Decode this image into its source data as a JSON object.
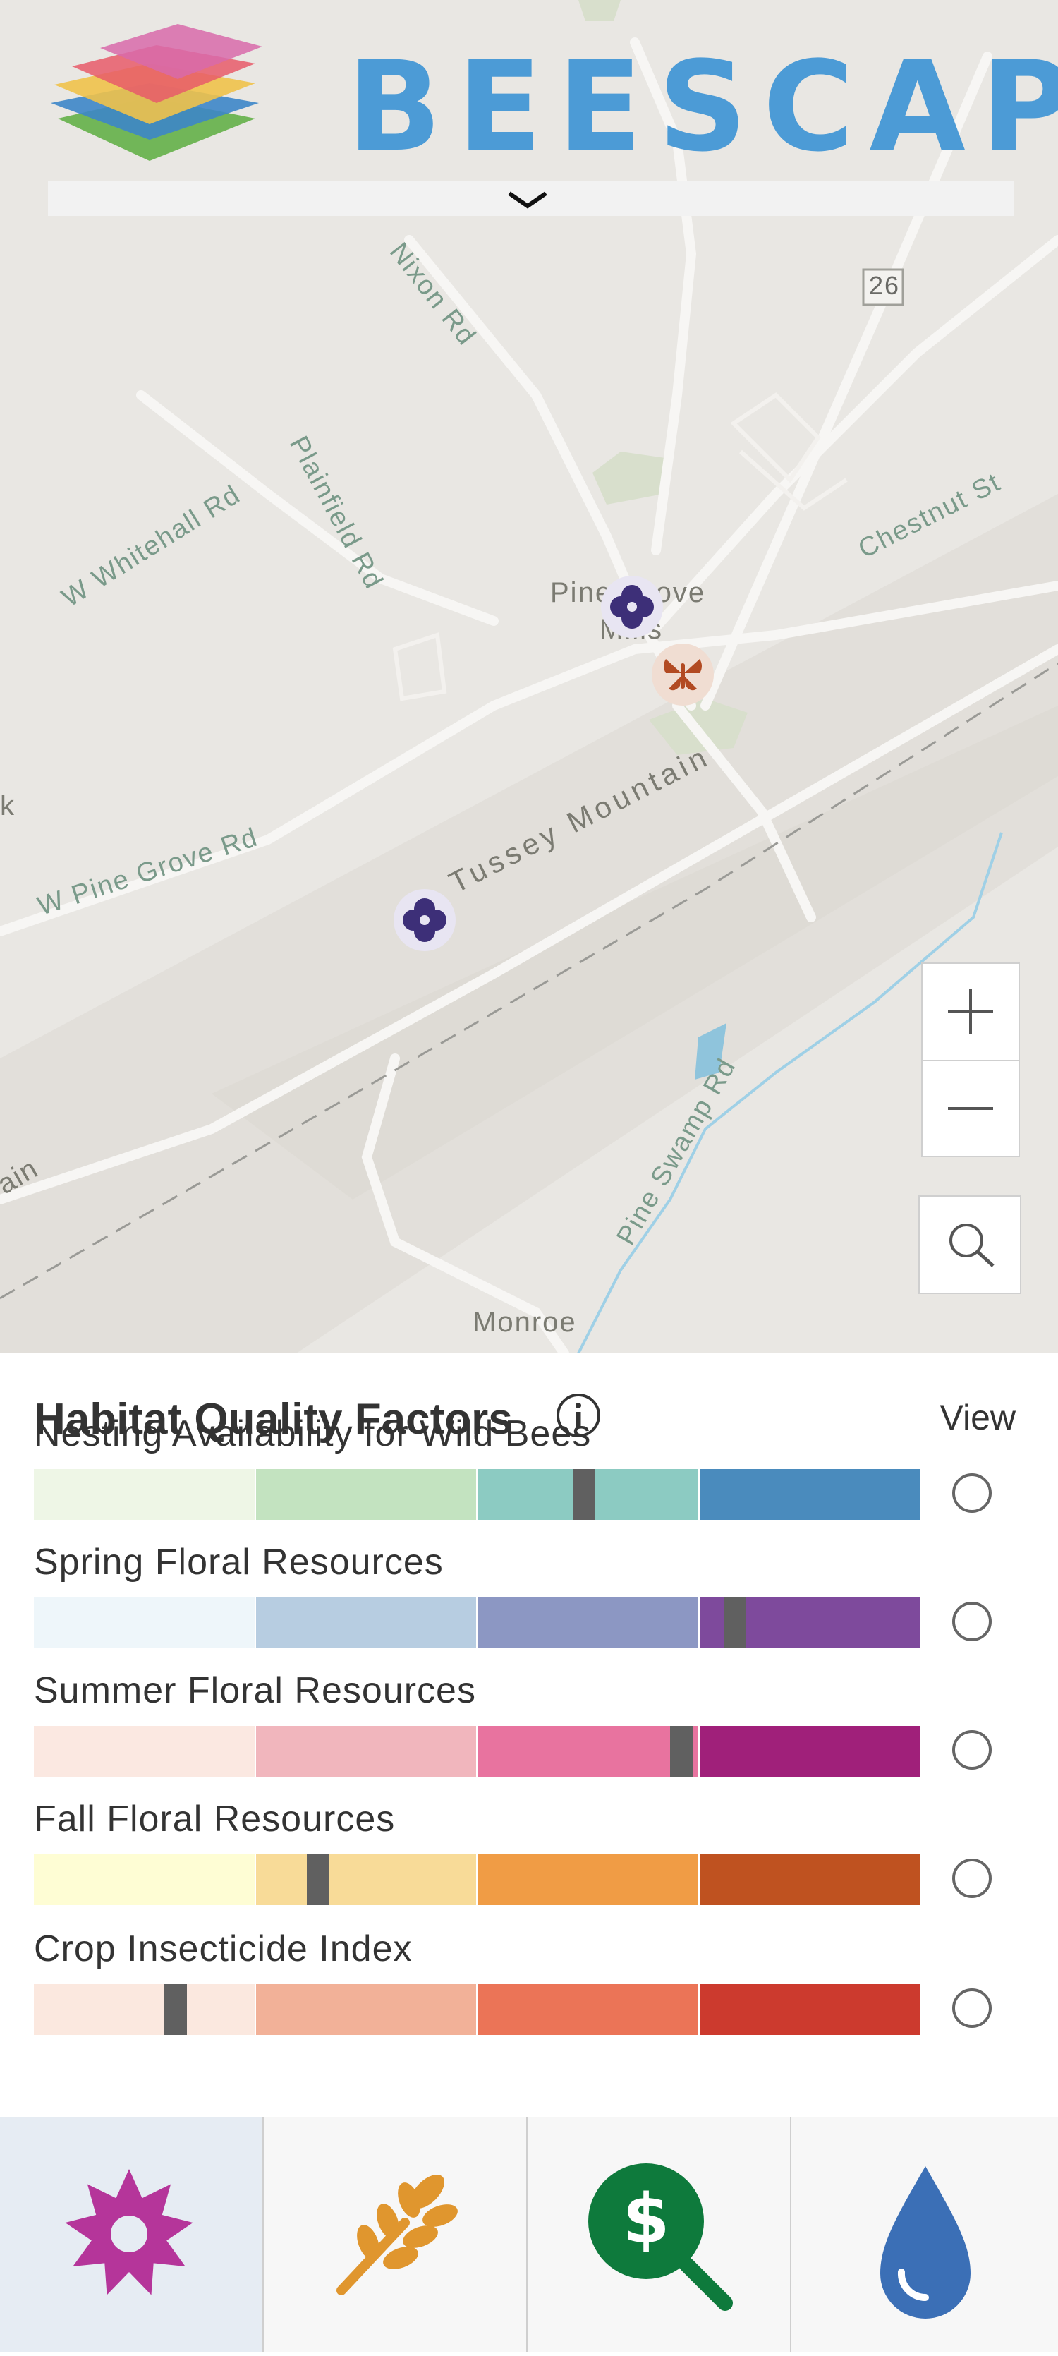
{
  "app": {
    "title": "BEESCAPE"
  },
  "map": {
    "road_labels": [
      "Nixon Rd",
      "W Whitehall Rd",
      "Plainfield Rd",
      "Chestnut St",
      "W Pine Grove Rd",
      "Pine Swamp Rd"
    ],
    "place_labels": {
      "pine_grove": "Pine Grove",
      "mills": "Mills",
      "tussey": "Tussey Mountain",
      "monroe": "Monroe",
      "k": "k",
      "ain": "ain"
    },
    "shield": "26",
    "markers": [
      "flower-marker",
      "butterfly-marker",
      "flower-marker"
    ],
    "zoom_in": "+",
    "zoom_out": "−"
  },
  "panel": {
    "title": "Habitat Quality Factors",
    "view_label": "View",
    "factors": [
      {
        "label": "Nesting Availability for Wild Bees",
        "colors": [
          "#eef6e6",
          "#c3e3c0",
          "#8ccbc2",
          "#8ccbc2",
          "#4a8bbd"
        ],
        "marker": 0.62
      },
      {
        "label": "Spring Floral Resources",
        "colors": [
          "#eef6fa",
          "#b7cde1",
          "#8c97c3",
          "#7e4a9c",
          "#7e4a9c"
        ],
        "marker": 0.79
      },
      {
        "label": "Summer Floral Resources",
        "colors": [
          "#fbe8e1",
          "#f1b6bd",
          "#e8739f",
          "#e8739f",
          "#a0207a"
        ],
        "marker": 0.73
      },
      {
        "label": "Fall Floral Resources",
        "colors": [
          "#fefdd4",
          "#f8db98",
          "#f09c45",
          "#f09c45",
          "#bf5220"
        ],
        "marker": 0.32
      },
      {
        "label": "Crop Insecticide Index",
        "colors": [
          "#fbe8df",
          "#f2b198",
          "#eb7457",
          "#eb7457",
          "#cc3a2e"
        ],
        "marker": 0.16
      }
    ]
  },
  "tabs": [
    {
      "name": "floral-tab",
      "icon": "flower-burst-icon",
      "color": "#b5359a"
    },
    {
      "name": "crop-tab",
      "icon": "wheat-icon",
      "color": "#e0962e"
    },
    {
      "name": "economic-tab",
      "icon": "dollar-search-icon",
      "color": "#0e7a3c"
    },
    {
      "name": "water-tab",
      "icon": "water-drop-icon",
      "color": "#3b6fb6"
    }
  ]
}
